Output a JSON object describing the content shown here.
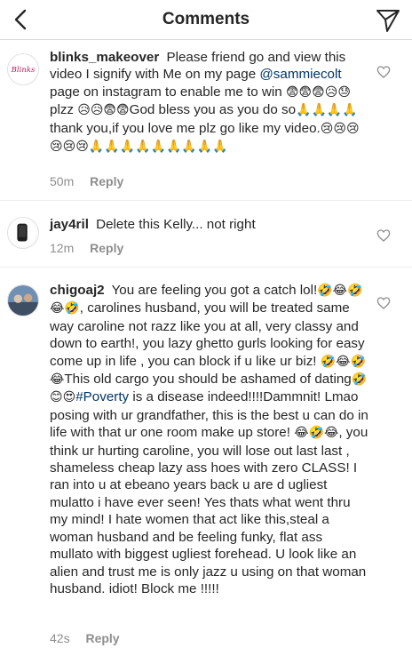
{
  "header": {
    "title": "Comments",
    "back_icon": "chevron-left-icon",
    "send_icon": "paper-plane-icon"
  },
  "comments": [
    {
      "username": "blinks_makeover",
      "avatar_text": "Blinks",
      "text_1": " Please friend go and view this video I signify with Me on my page ",
      "mention": "@sammiecolt",
      "text_2": " page on instagram to enable me to win ",
      "emoji_1": "😨😨😨😥😓",
      "text_3": "plzz ",
      "emoji_2": "😥😥😨😨",
      "text_4": "God bless you as you do so",
      "emoji_3": "🙏🙏🙏🙏",
      "text_5": "thank you,if you love me plz go like my video.",
      "emoji_4": "😢😢😢😢😢😢🙏🙏🙏🙏🙏🙏🙏🙏🙏",
      "time": "50m",
      "reply": "Reply"
    },
    {
      "username": "jay4ril",
      "text": " Delete this Kelly... not right",
      "time": "12m",
      "reply": "Reply"
    },
    {
      "username": "chigoaj2",
      "text_1": " You are feeling you got a catch lol!",
      "emoji_1": "🤣😂🤣😂🤣",
      "text_2": ", carolines husband, you will be treated same way caroline not razz like you at all, very classy and down to earth!, you lazy ghetto  gurls looking for easy come up in life , you can block if u like ur biz! ",
      "emoji_2": "🤣😂🤣😂",
      "text_3": "This old cargo you should be ashamed of dating",
      "emoji_3": "🤣😊😍",
      "hashtag": "#Poverty",
      "text_4": " is a disease indeed!!!!Dammnit! Lmao posing with ur grandfather, this is the best u can do in life with that ur one room make up store! ",
      "emoji_4": "😂🤣😂",
      "text_5": ", you think ur hurting caroline, you will lose out last last , shameless cheap lazy ass hoes with zero CLASS! I ran into u at ebeano years back u are d ugliest mulatto i have ever seen! Yes thats what went thru my mind! I hate women that act like this,steal a woman husband and be feeling funky, flat ass mullato with biggest ugliest forehead. U look like an alien and trust me is only jazz u using on that woman husband. idiot! Block me !!!!!",
      "time": "42s",
      "reply": "Reply"
    }
  ],
  "colors": {
    "mention": "#003569",
    "meta": "#8e8e8e",
    "avatar_brand": "#c2185b"
  }
}
